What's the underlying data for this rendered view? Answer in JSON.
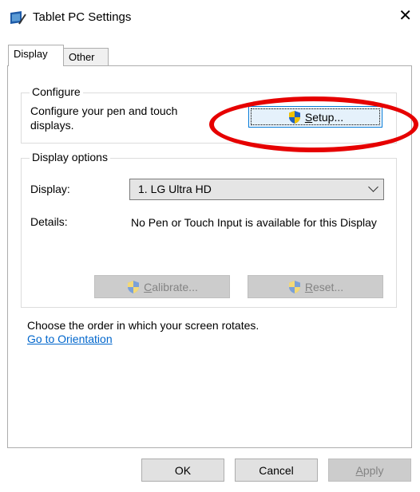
{
  "window": {
    "title": "Tablet PC Settings",
    "close_symbol": "✕"
  },
  "tabs": [
    {
      "label": "Display"
    },
    {
      "label": "Other"
    }
  ],
  "configure": {
    "group_title": "Configure",
    "description": "Configure your pen and touch displays.",
    "setup_button": {
      "prefix": "S",
      "rest": "etup..."
    }
  },
  "display_options": {
    "group_title": "Display options",
    "display_label": "Display:",
    "display_value": "1. LG Ultra HD",
    "details_label": "Details:",
    "details_text": "No Pen or Touch Input is available for this Display",
    "calibrate_button": {
      "prefix": "C",
      "rest": "alibrate..."
    },
    "reset_button": {
      "prefix": "R",
      "rest": "eset..."
    }
  },
  "orientation": {
    "text": "Choose the order in which your screen rotates.",
    "link": "Go to Orientation"
  },
  "footer": {
    "ok": "OK",
    "cancel": "Cancel",
    "apply": {
      "prefix": "A",
      "rest": "pply"
    }
  },
  "colors": {
    "highlight_ellipse": "#e60000",
    "link": "#0066cc",
    "focus_border": "#0078d7"
  }
}
